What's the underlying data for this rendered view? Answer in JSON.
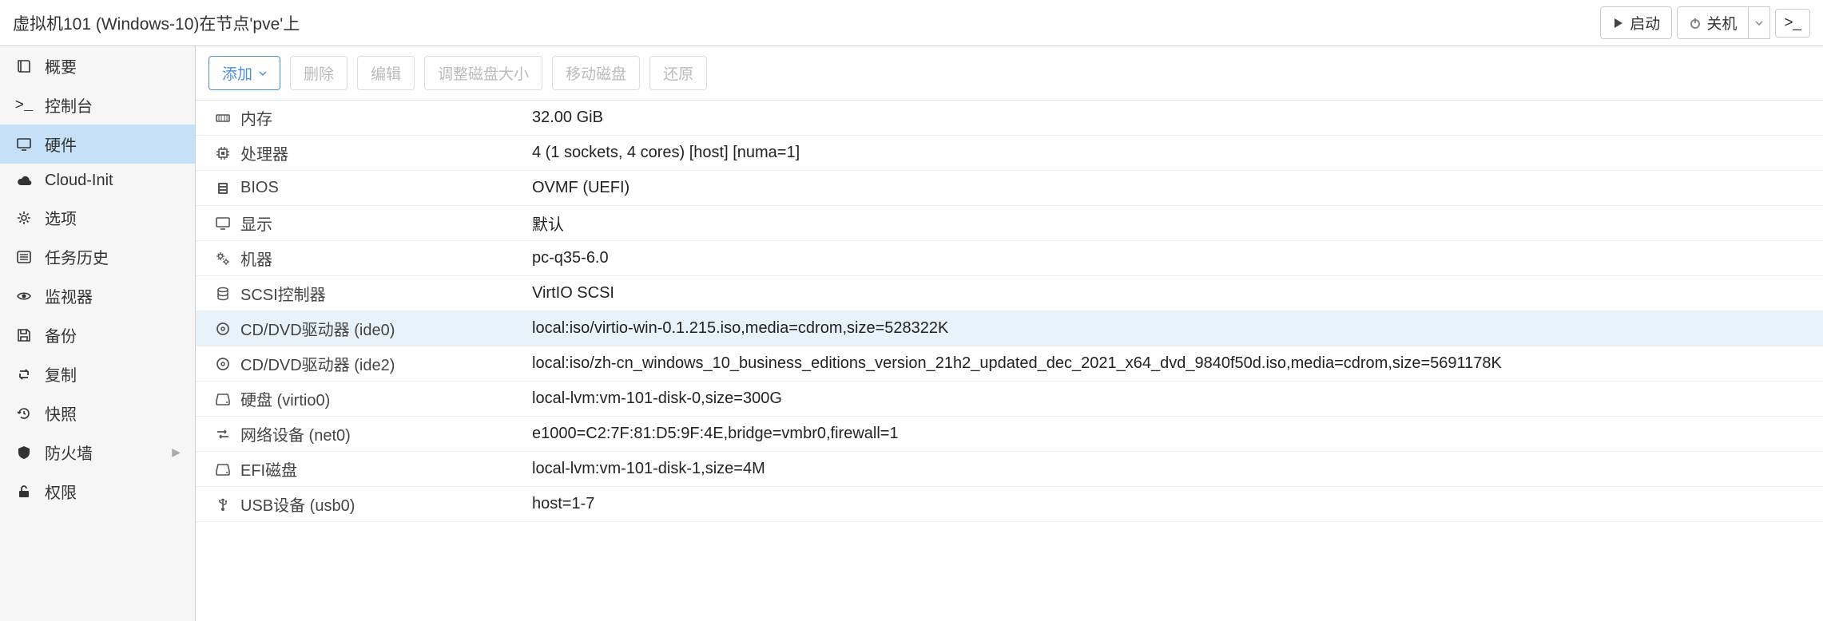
{
  "header": {
    "title": "虚拟机101 (Windows-10)在节点'pve'上",
    "start_button": "启动",
    "shutdown_button": "关机"
  },
  "sidebar": {
    "items": [
      {
        "icon": "book",
        "label": "概要"
      },
      {
        "icon": "terminal",
        "label": "控制台"
      },
      {
        "icon": "monitor",
        "label": "硬件"
      },
      {
        "icon": "cloud",
        "label": "Cloud-Init"
      },
      {
        "icon": "gear",
        "label": "选项"
      },
      {
        "icon": "list",
        "label": "任务历史"
      },
      {
        "icon": "eye",
        "label": "监视器"
      },
      {
        "icon": "save",
        "label": "备份"
      },
      {
        "icon": "retweet",
        "label": "复制"
      },
      {
        "icon": "history",
        "label": "快照"
      },
      {
        "icon": "shield",
        "label": "防火墙"
      },
      {
        "icon": "unlock",
        "label": "权限"
      }
    ],
    "active_index": 2,
    "submenu_index": 10
  },
  "toolbar": {
    "add": "添加",
    "remove": "删除",
    "edit": "编辑",
    "resize_disk": "调整磁盘大小",
    "move_disk": "移动磁盘",
    "revert": "还原"
  },
  "hardware": {
    "rows": [
      {
        "icon": "memory",
        "name": "内存",
        "value": "32.00 GiB"
      },
      {
        "icon": "cpu",
        "name": "处理器",
        "value": "4 (1 sockets, 4 cores) [host] [numa=1]"
      },
      {
        "icon": "bios",
        "name": "BIOS",
        "value": "OVMF (UEFI)"
      },
      {
        "icon": "display",
        "name": "显示",
        "value": "默认"
      },
      {
        "icon": "gears",
        "name": "机器",
        "value": "pc-q35-6.0"
      },
      {
        "icon": "db",
        "name": "SCSI控制器",
        "value": "VirtIO SCSI"
      },
      {
        "icon": "disc",
        "name": "CD/DVD驱动器 (ide0)",
        "value": "local:iso/virtio-win-0.1.215.iso,media=cdrom,size=528322K"
      },
      {
        "icon": "disc",
        "name": "CD/DVD驱动器 (ide2)",
        "value": "local:iso/zh-cn_windows_10_business_editions_version_21h2_updated_dec_2021_x64_dvd_9840f50d.iso,media=cdrom,size=5691178K"
      },
      {
        "icon": "hdd",
        "name": "硬盘 (virtio0)",
        "value": "local-lvm:vm-101-disk-0,size=300G"
      },
      {
        "icon": "net",
        "name": "网络设备 (net0)",
        "value": "e1000=C2:7F:81:D5:9F:4E,bridge=vmbr0,firewall=1"
      },
      {
        "icon": "hdd",
        "name": "EFI磁盘",
        "value": "local-lvm:vm-101-disk-1,size=4M"
      },
      {
        "icon": "usb",
        "name": "USB设备 (usb0)",
        "value": "host=1-7"
      }
    ],
    "selected_index": 6
  }
}
